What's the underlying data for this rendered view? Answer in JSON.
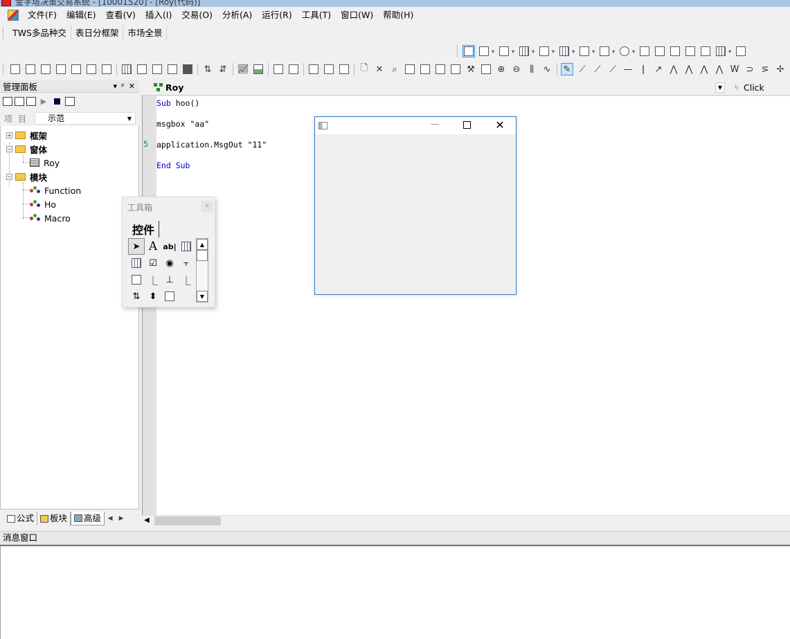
{
  "window": {
    "title": "金字塔决策交易系统 - [10001520] - [Roy(代码)]"
  },
  "menu": [
    "文件(F)",
    "编辑(E)",
    "查看(V)",
    "插入(I)",
    "交易(O)",
    "分析(A)",
    "运行(R)",
    "工具(T)",
    "窗口(W)",
    "帮助(H)"
  ],
  "quick_tabs": [
    "TWS多品种交",
    "表日分框架",
    "市场全景"
  ],
  "manager_panel": {
    "title": "管理面板",
    "header_buttons": [
      "▾",
      "ᵖ",
      "✕"
    ],
    "project_label": "项目",
    "project_value": "示范",
    "tree": {
      "framework": "框架",
      "forms": "窗体",
      "form_items": [
        "Roy"
      ],
      "modules": "模块",
      "module_items": [
        "Function",
        "Ho",
        "Macro"
      ]
    },
    "bottom_tabs": [
      "公式",
      "板块",
      "高级"
    ]
  },
  "editor": {
    "module_name": "Roy",
    "event_name": "Click",
    "code_lines": [
      {
        "kw": "Sub",
        "rest": " hoo()"
      },
      {
        "kw": "",
        "rest": "msgbox \"aa\""
      },
      {
        "kw": "",
        "rest": "application.MsgOut \"11\""
      },
      {
        "kw": "End Sub",
        "rest": ""
      }
    ],
    "line_marker": "5"
  },
  "message_window": {
    "title": "消息窗口"
  },
  "toolbox": {
    "title": "工具箱",
    "tab_label": "控件",
    "tools": [
      "pointer",
      "A",
      "ab|",
      "listbox",
      "frame",
      "checkbox",
      "radio",
      "combo",
      "tabstrip",
      "hline",
      "hslider",
      "vslider",
      "spin",
      "updown",
      "image"
    ]
  },
  "form_window": {
    "min_glyph": "—",
    "close_glyph": "✕"
  },
  "colors": {
    "keyword": "#0000c0",
    "accent_border": "#2b79c9",
    "line_marker": "#0a7a8a"
  }
}
